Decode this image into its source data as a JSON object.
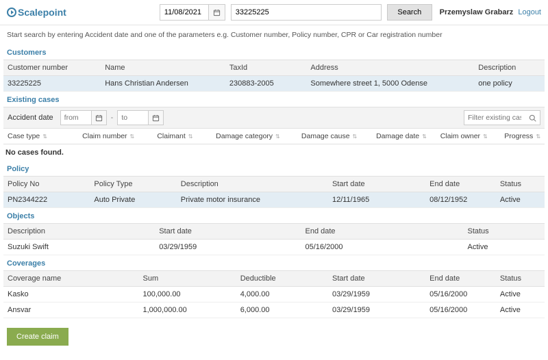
{
  "header": {
    "brand": "Scalepoint",
    "date_value": "11/08/2021",
    "query_value": "33225225",
    "search_label": "Search",
    "user_name": "Przemyslaw Grabarz",
    "logout_label": "Logout"
  },
  "hint": "Start search by entering Accident date and one of the parameters e.g. Customer number, Policy number, CPR or Car registration number",
  "customers": {
    "title": "Customers",
    "columns": [
      "Customer number",
      "Name",
      "TaxId",
      "Address",
      "Description"
    ],
    "rows": [
      {
        "number": "33225225",
        "name": "Hans Christian Andersen",
        "taxid": "230883-2005",
        "address": "Somewhere street 1, 5000 Odense",
        "description": "one policy"
      }
    ]
  },
  "cases": {
    "title": "Existing cases",
    "accident_date_label": "Accident date",
    "from_placeholder": "from",
    "to_placeholder": "to",
    "filter_placeholder": "Filter existing cases",
    "columns": [
      "Case type",
      "Claim number",
      "Claimant",
      "Damage category",
      "Damage cause",
      "Damage date",
      "Claim owner",
      "Progress"
    ],
    "empty_text": "No cases found."
  },
  "policy": {
    "title": "Policy",
    "columns": [
      "Policy No",
      "Policy Type",
      "Description",
      "Start date",
      "End date",
      "Status"
    ],
    "rows": [
      {
        "no": "PN2344222",
        "type": "Auto Private",
        "desc": "Private motor insurance",
        "start": "12/11/1965",
        "end": "08/12/1952",
        "status": "Active"
      }
    ]
  },
  "objects": {
    "title": "Objects",
    "columns": [
      "Description",
      "Start date",
      "End date",
      "Status"
    ],
    "rows": [
      {
        "desc": "Suzuki Swift",
        "start": "03/29/1959",
        "end": "05/16/2000",
        "status": "Active"
      }
    ]
  },
  "coverages": {
    "title": "Coverages",
    "columns": [
      "Coverage name",
      "Sum",
      "Deductible",
      "Start date",
      "End date",
      "Status"
    ],
    "rows": [
      {
        "name": "Kasko",
        "sum": "100,000.00",
        "deductible": "4,000.00",
        "start": "03/29/1959",
        "end": "05/16/2000",
        "status": "Active"
      },
      {
        "name": "Ansvar",
        "sum": "1,000,000.00",
        "deductible": "6,000.00",
        "start": "03/29/1959",
        "end": "05/16/2000",
        "status": "Active"
      }
    ]
  },
  "create_label": "Create claim"
}
